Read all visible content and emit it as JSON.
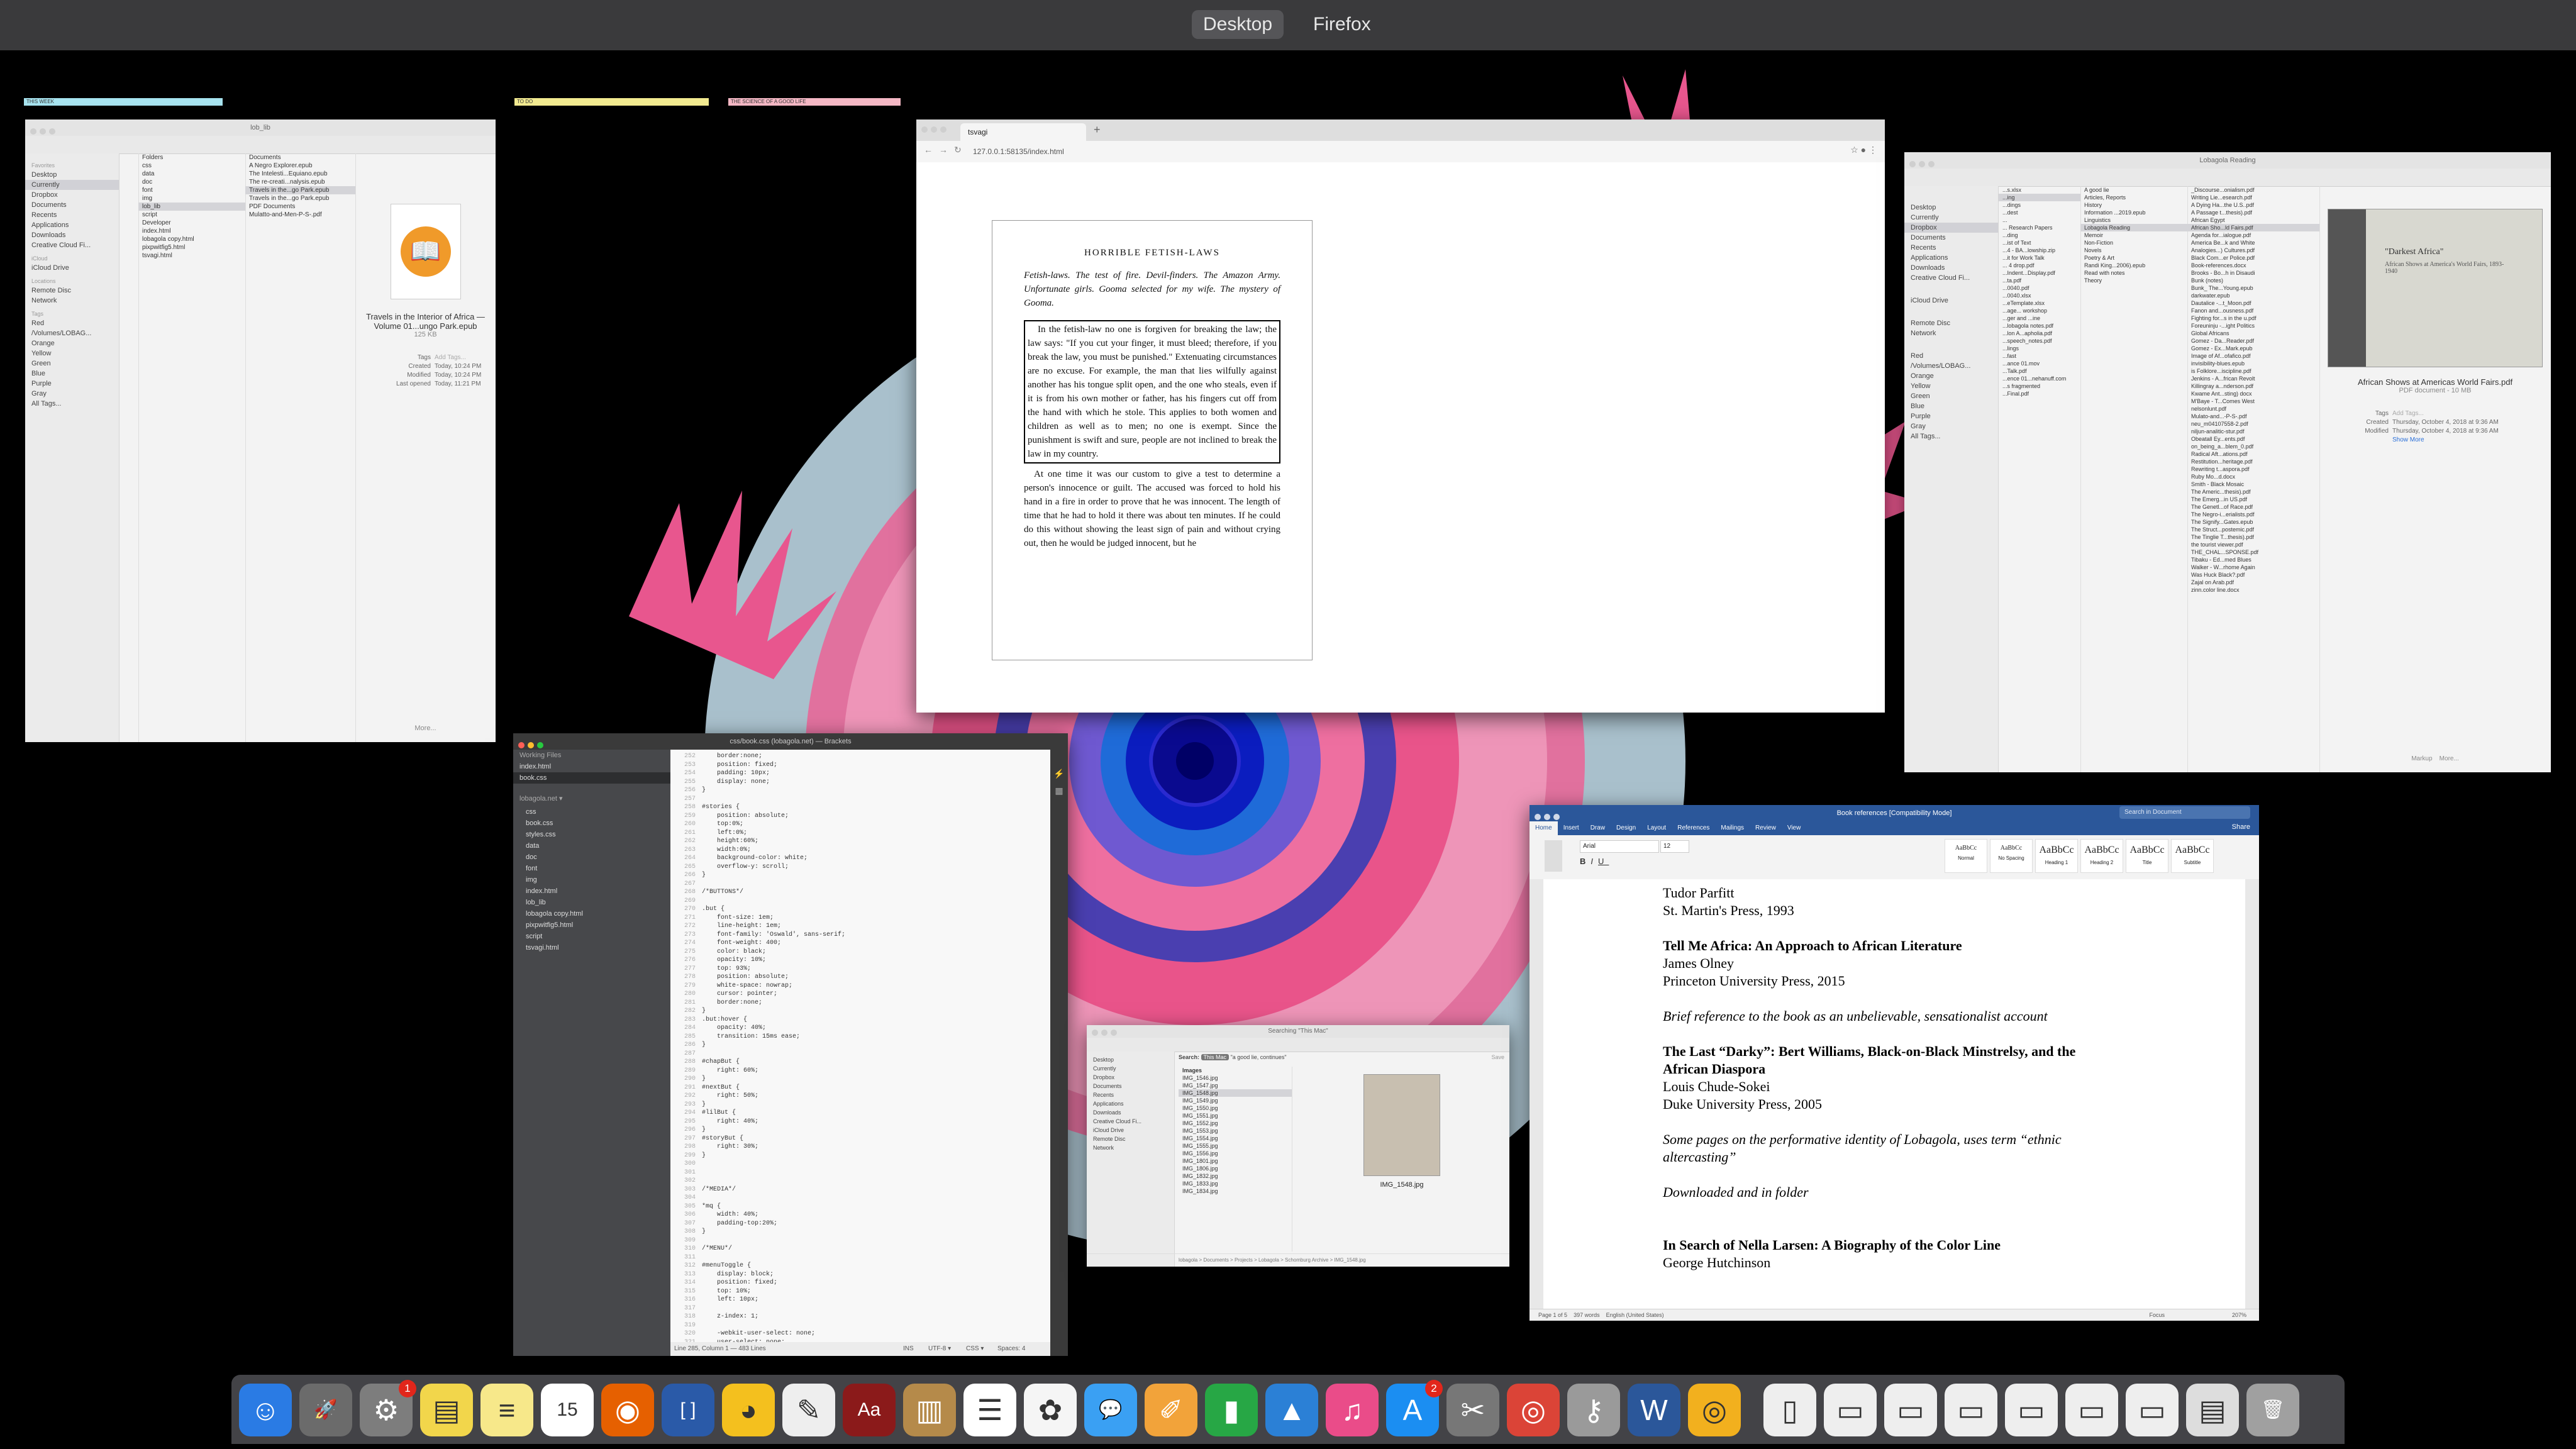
{
  "spaces": {
    "desktop_label": "Desktop",
    "firefox_label": "Firefox"
  },
  "stickies": [
    "THIS WEEK",
    "TO DO",
    "THE SCIENCE OF A GOOD LIFE"
  ],
  "finder1": {
    "title": "lob_lib",
    "sidebar_favorites_hdr": "Favorites",
    "favorites": [
      "Desktop",
      "Currently",
      "Dropbox",
      "Documents",
      "Recents",
      "Applications",
      "Downloads",
      "Creative Cloud Fi..."
    ],
    "icloud_hdr": "iCloud",
    "icloud": [
      "iCloud Drive"
    ],
    "locations_hdr": "Locations",
    "locations": [
      "Remote Disc",
      "Network"
    ],
    "tags_hdr": "Tags",
    "tags": [
      "Red",
      "/Volumes/LOBAG...",
      "Orange",
      "Yellow",
      "Green",
      "Blue",
      "Purple",
      "Gray",
      "All Tags..."
    ],
    "folders_hdr": "Folders",
    "folders": [
      "css",
      "data",
      "doc",
      "font",
      "img",
      "lob_lib",
      "script"
    ],
    "developer_hdr": "Developer",
    "developer": [
      "index.html",
      "lobagola copy.html",
      "pixpwitfig5.html",
      "tsvagi.html"
    ],
    "documents_hdr": "Documents",
    "documents": [
      "A Negro Explorer.epub",
      "The Intelesti...Equiano.epub",
      "The re-creati...nalysis.epub",
      "Travels in the...go Park.epub",
      "Travels in the...go Park.epub"
    ],
    "pdf_hdr": "PDF Documents",
    "pdfs": [
      "Mulatto-and-Men-P-S-.pdf"
    ],
    "preview_name": "Travels in the Interior of Africa — Volume 01...ungo Park.epub",
    "preview_size": "125 KB",
    "tags_label": "Tags",
    "add_tags": "Add Tags...",
    "created_label": "Created",
    "created": "Today, 10:24 PM",
    "modified_label": "Modified",
    "modified": "Today, 10:24 PM",
    "last_opened_label": "Last opened",
    "last_opened": "Today, 11:21 PM",
    "more": "More..."
  },
  "browser": {
    "tab_title": "tsvagi",
    "url": "127.0.0.1:58135/index.html",
    "book_title": "HORRIBLE FETISH-LAWS",
    "intro": "Fetish-laws. The test of fire. Devil-finders. The Amazon Army. Unfortunate girls. Gooma selected for my wife. The mystery of Gooma.",
    "boxed_para": "In the fetish-law no one is forgiven for breaking the law; the law says: \"If you cut your finger, it must bleed; therefore, if you break the law, you must be punished.\" Extenuating circumstances are no excuse. For example, the man that lies wilfully against another has his tongue split open, and the one who steals, even if it is from his own mother or father, has his fingers cut off from the hand with which he stole. This applies to both women and children as well as to men; no one is exempt. Since the punishment is swift and sure, people are not inclined to break the law in my country.",
    "para2": "At one time it was our custom to give a test to determine a person's innocence or guilt. The accused was forced to hold his hand in a fire in order to prove that he was innocent. The length of time that he had to hold it there was about ten minutes. If he could do this without showing the least sign of pain and without crying out, then he would be judged innocent, but he"
  },
  "finder2": {
    "title": "Lobagola Reading",
    "favorites": [
      "Desktop",
      "Currently",
      "Dropbox",
      "Documents",
      "Recents",
      "Applications",
      "Downloads",
      "Creative Cloud Fi..."
    ],
    "icloud": [
      "iCloud Drive"
    ],
    "locations": [
      "Remote Disc",
      "Network"
    ],
    "tags": [
      "Red",
      "/Volumes/LOBAG...",
      "Orange",
      "Yellow",
      "Green",
      "Blue",
      "Purple",
      "Gray",
      "All Tags..."
    ],
    "col1": [
      "...s.xlsx",
      "...ing",
      "...dings",
      "...dest",
      "...",
      "... Research Papers",
      "...ding",
      "...ist of Text",
      "...4 - BA...lowship.zip",
      "...it for Work Talk",
      "... 4 drop.pdf",
      "...Indent...Display.pdf",
      "...ta.pdf",
      "...0040.pdf",
      "...0040.xlsx",
      "...eTemplate.xlsx",
      "...age... workshop",
      "...ger and ...ine",
      "...lobagola notes.pdf",
      "...lon A...apholia.pdf",
      "...speech_notes.pdf",
      "...lings",
      "...fast",
      "...ance 01.mov",
      "...Talk.pdf",
      "...ence 01...nehanuff.com",
      "...s fragmented",
      "...Final.pdf"
    ],
    "col2": [
      "A good lie",
      "Articles, Reports",
      "History",
      "Information ...2019.epub",
      "Linguistics",
      "Lobagola Reading",
      "Memoir",
      "Non-Fiction",
      "Novels",
      "Poetry & Art",
      "Randi King...2006).epub",
      "Read with notes",
      "Theory"
    ],
    "col3": [
      "_Discourse...onialism.pdf",
      "Writing Lie...esearch.pdf",
      "A Dying Ha...the U.S..pdf",
      "A Passage t...thesis).pdf",
      "African Egypt",
      "African Sho...ld Fairs.pdf",
      "Agenda for...ialogue.pdf",
      "America Be...k and White",
      "Analogies...) Cultures.pdf",
      "Black Com...er Police.pdf",
      "Book-references.docx",
      "Brooks - Bo...h in Disaudi",
      "Bunk (notes)",
      "Bunk_ The...Young.epub",
      "darkwater.epub",
      "Dautalice -...t_Moon.pdf",
      "Fanon and...ousness.pdf",
      "Fighting for...s in the u.pdf",
      "Foreuninju -...ight Politics",
      "Global Africans",
      "Gomez - Da...Reader.pdf",
      "Gomez - Ex...Mark.epub",
      "Image of Af...ofafico.pdf",
      "invisibility-blues.epub",
      "is Folklore...iscipline.pdf",
      "Jenkins - A...frican Revolt",
      "Killingray a...nderson.pdf",
      "Kwame Ant...sting) docx",
      "M'Baye - T...Comes West",
      "nelsonlunt.pdf",
      "Mulato-and...-P-S-.pdf",
      "neu_m04107558-2.pdf",
      "niljun-analitic-stur.pdf",
      "Obeatall Ey...ents.pdf",
      "on_being_a...blem_0.pdf",
      "Radical Aft...ations.pdf",
      "Restitution...heritage.pdf",
      "Rewriting t...aspora.pdf",
      "Ruby Mo...d.docx",
      "Smith - Black Mosaic",
      "The Americ...thesis).pdf",
      "The Emerg...in US.pdf",
      "The Genetl...of Race.pdf",
      "The Negro-i...erialists.pdf",
      "The Signify...Gates.epub",
      "The Struct...postemic.pdf",
      "The Tinglie T...thesis).pdf",
      "the tourist viewer.pdf",
      "THE_CHAL...SPONSE.pdf",
      "Tibaku - Ed...med Blues",
      "Walker - W...rhome Again",
      "Was Huck Black?.pdf",
      "Zajal on Arab.pdf",
      "zinn.color line.docx"
    ],
    "preview_name": "African Shows at Americas World Fairs.pdf",
    "preview_kind": "PDF document - 10 MB",
    "preview_page_title": "\"Darkest Africa\"",
    "preview_page_sub": "African Shows at America's World Fairs, 1893-1940",
    "tags_label": "Tags",
    "add_tags": "Add Tags...",
    "created_label": "Created",
    "created": "Thursday, October 4, 2018 at 9:36 AM",
    "modified_label": "Modified",
    "modified": "Thursday, October 4, 2018 at 9:36 AM",
    "show_more": "Show More",
    "markup": "Markup",
    "more": "More..."
  },
  "brackets": {
    "title": "css/book.css (lobagola.net) — Brackets",
    "working_files_hdr": "Working Files",
    "working_files": [
      "index.html",
      "book.css"
    ],
    "project_hdr": "lobagola.net ▾",
    "tree": [
      "css",
      "book.css",
      "styles.css",
      "data",
      "doc",
      "font",
      "img",
      "index.html",
      "lob_lib",
      "lobagola copy.html",
      "pixpwitfig5.html",
      "script",
      "tsvagi.html"
    ],
    "code_lines": [
      [
        "252",
        "    border:none;"
      ],
      [
        "253",
        "    position: fixed;"
      ],
      [
        "254",
        "    padding: 10px;"
      ],
      [
        "255",
        "    display: none;"
      ],
      [
        "256",
        "}"
      ],
      [
        "257",
        ""
      ],
      [
        "258",
        "#stories {"
      ],
      [
        "259",
        "    position: absolute;"
      ],
      [
        "260",
        "    top:0%;"
      ],
      [
        "261",
        "    left:0%;"
      ],
      [
        "262",
        "    height:60%;"
      ],
      [
        "263",
        "    width:0%;"
      ],
      [
        "264",
        "    background-color: white;"
      ],
      [
        "265",
        "    overflow-y: scroll;"
      ],
      [
        "266",
        "}"
      ],
      [
        "267",
        ""
      ],
      [
        "268",
        "/*BUTTONS*/"
      ],
      [
        "269",
        ""
      ],
      [
        "270",
        ".but {"
      ],
      [
        "271",
        "    font-size: 1em;"
      ],
      [
        "272",
        "    line-height: 1em;"
      ],
      [
        "273",
        "    font-family: 'Oswald', sans-serif;"
      ],
      [
        "274",
        "    font-weight: 400;"
      ],
      [
        "275",
        "    color: black;"
      ],
      [
        "276",
        "    opacity: 10%;"
      ],
      [
        "277",
        "    top: 93%;"
      ],
      [
        "278",
        "    position: absolute;"
      ],
      [
        "279",
        "    white-space: nowrap;"
      ],
      [
        "280",
        "    cursor: pointer;"
      ],
      [
        "281",
        "    border:none;"
      ],
      [
        "282",
        "}"
      ],
      [
        "283",
        ".but:hover {"
      ],
      [
        "284",
        "    opacity: 40%;"
      ],
      [
        "285",
        "    transition: 15ms ease;"
      ],
      [
        "286",
        "}"
      ],
      [
        "287",
        ""
      ],
      [
        "288",
        "#chapBut {"
      ],
      [
        "289",
        "    right: 60%;"
      ],
      [
        "290",
        "}"
      ],
      [
        "291",
        "#nextBut {"
      ],
      [
        "292",
        "    right: 50%;"
      ],
      [
        "293",
        "}"
      ],
      [
        "294",
        "#lilBut {"
      ],
      [
        "295",
        "    right: 40%;"
      ],
      [
        "296",
        "}"
      ],
      [
        "297",
        "#storyBut {"
      ],
      [
        "298",
        "    right: 30%;"
      ],
      [
        "299",
        "}"
      ],
      [
        "300",
        ""
      ],
      [
        "301",
        ""
      ],
      [
        "302",
        ""
      ],
      [
        "303",
        "/*MEDIA*/"
      ],
      [
        "304",
        ""
      ],
      [
        "305",
        "*mq {"
      ],
      [
        "306",
        "    width: 40%;"
      ],
      [
        "307",
        "    padding-top:20%;"
      ],
      [
        "308",
        "}"
      ],
      [
        "309",
        ""
      ],
      [
        "310",
        "/*MENU*/"
      ],
      [
        "311",
        ""
      ],
      [
        "312",
        "#menuToggle {"
      ],
      [
        "313",
        "    display: block;"
      ],
      [
        "314",
        "    position: fixed;"
      ],
      [
        "315",
        "    top: 10%;"
      ],
      [
        "316",
        "    left: 10px;"
      ],
      [
        "317",
        ""
      ],
      [
        "318",
        "    z-index: 1;"
      ],
      [
        "319",
        ""
      ],
      [
        "320",
        "    -webkit-user-select: none;"
      ],
      [
        "321",
        "    user-select: none;"
      ]
    ],
    "status": "Line 285, Column 1 — 483 Lines",
    "ins": "INS",
    "encoding": "UTF-8 ▾",
    "lang": "CSS ▾",
    "spaces": "Spaces: 4"
  },
  "finder3": {
    "title": "Searching \"This Mac\"",
    "favorites": [
      "Desktop",
      "Currently",
      "Dropbox",
      "Documents",
      "Recents",
      "Applications",
      "Downloads",
      "Creative Cloud Fi..."
    ],
    "icloud": [
      "iCloud Drive"
    ],
    "locations": [
      "Remote Disc",
      "Network"
    ],
    "search_label": "Search:",
    "scope": "This Mac",
    "query": "\"a good lie, continues\"",
    "save": "Save",
    "images_hdr": "Images",
    "files": [
      "IMG_1546.jpg",
      "IMG_1547.jpg",
      "IMG_1548.jpg",
      "IMG_1549.jpg",
      "IMG_1550.jpg",
      "IMG_1551.jpg",
      "IMG_1552.jpg",
      "IMG_1553.jpg",
      "IMG_1554.jpg",
      "IMG_1555.jpg",
      "IMG_1556.jpg",
      "IMG_1801.jpg",
      "IMG_1806.jpg",
      "IMG_1832.jpg",
      "IMG_1833.jpg",
      "IMG_1834.jpg"
    ],
    "preview_name": "IMG_1548.jpg",
    "path": "lobagola > Documents > Projects > Lobagola > Schomburg Archive > IMG_1548.jpg"
  },
  "word": {
    "title": "Book references [Compatibility Mode]",
    "search_placeholder": "Search in Document",
    "tabs": [
      "Home",
      "Insert",
      "Draw",
      "Design",
      "Layout",
      "References",
      "Mailings",
      "Review",
      "View"
    ],
    "share": "Share",
    "font": "Arial",
    "size": "12",
    "styles": [
      "Normal",
      "No Spacing",
      "Heading 1",
      "Heading 2",
      "Title",
      "Subtitle"
    ],
    "lines": [
      {
        "t": "Tudor Parfitt",
        "s": ""
      },
      {
        "t": "St. Martin's Press, 1993",
        "s": ""
      },
      {
        "t": "",
        "s": "gap"
      },
      {
        "t": "Tell Me Africa: An Approach to African Literature",
        "s": "b"
      },
      {
        "t": "James Olney",
        "s": ""
      },
      {
        "t": "Princeton University Press, 2015",
        "s": ""
      },
      {
        "t": "",
        "s": "gap"
      },
      {
        "t": "Brief reference to the book as an unbelievable, sensationalist account",
        "s": "i"
      },
      {
        "t": "",
        "s": "gap"
      },
      {
        "t": "The Last “Darky”: Bert Williams, Black-on-Black Minstrelsy, and the",
        "s": "b"
      },
      {
        "t": "African Diaspora",
        "s": "b"
      },
      {
        "t": "Louis Chude-Sokei",
        "s": ""
      },
      {
        "t": "Duke University Press, 2005",
        "s": ""
      },
      {
        "t": "",
        "s": "gap"
      },
      {
        "t": "Some pages on the performative identity of Lobagola, uses term “ethnic",
        "s": "i"
      },
      {
        "t": "altercasting”",
        "s": "i"
      },
      {
        "t": "",
        "s": "gap"
      },
      {
        "t": "Downloaded and in folder",
        "s": "i"
      },
      {
        "t": "",
        "s": "gap"
      },
      {
        "t": "",
        "s": "gap"
      },
      {
        "t": "In Search of Nella Larsen: A Biography of the Color Line",
        "s": "b"
      },
      {
        "t": "George Hutchinson",
        "s": ""
      }
    ],
    "status_page": "Page 1 of 5",
    "status_words": "397 words",
    "status_lang": "English (United States)",
    "focus": "Focus",
    "zoom": "207%"
  },
  "dock": {
    "items": [
      {
        "name": "finder-icon",
        "glyph": "☺",
        "color": "#2a7be4"
      },
      {
        "name": "launchpad-icon",
        "glyph": "🚀",
        "color": "#6b6b6b"
      },
      {
        "name": "system-preferences-icon",
        "glyph": "⚙",
        "color": "#7d7d7d",
        "badge": "1"
      },
      {
        "name": "stickies-icon",
        "glyph": "▤",
        "color": "#f2d64b"
      },
      {
        "name": "notes-icon",
        "glyph": "≡",
        "color": "#f7e88a"
      },
      {
        "name": "calendar-icon",
        "glyph": "15",
        "color": "#ffffff"
      },
      {
        "name": "firefox-icon",
        "glyph": "◉",
        "color": "#e66000"
      },
      {
        "name": "brackets-icon",
        "glyph": "[ ]",
        "color": "#2a5aa8"
      },
      {
        "name": "cyberduck-icon",
        "glyph": "◕",
        "color": "#f4c01e"
      },
      {
        "name": "textedit-icon",
        "glyph": "✎",
        "color": "#eeeeee"
      },
      {
        "name": "dictionary-icon",
        "glyph": "Aa",
        "color": "#8b1a1a"
      },
      {
        "name": "notebook-icon",
        "glyph": "▥",
        "color": "#b58a4a"
      },
      {
        "name": "reminders-icon",
        "glyph": "☰",
        "color": "#ffffff"
      },
      {
        "name": "photos-icon",
        "glyph": "✿",
        "color": "#f5f5f5"
      },
      {
        "name": "messages-icon",
        "glyph": "💬",
        "color": "#3aa0f3"
      },
      {
        "name": "pages-icon",
        "glyph": "✐",
        "color": "#f2a33a"
      },
      {
        "name": "numbers-icon",
        "glyph": "▮",
        "color": "#27a745"
      },
      {
        "name": "keynote-icon",
        "glyph": "▲",
        "color": "#2b80d6"
      },
      {
        "name": "itunes-icon",
        "glyph": "♫",
        "color": "#ea4c89"
      },
      {
        "name": "app-store-icon",
        "glyph": "A",
        "color": "#1b8ef2",
        "badge": "2"
      },
      {
        "name": "utilities-icon",
        "glyph": "✂",
        "color": "#777777"
      },
      {
        "name": "chrome-icon",
        "glyph": "◎",
        "color": "#db4437"
      },
      {
        "name": "keychain-icon",
        "glyph": "⚷",
        "color": "#9a9a9a"
      },
      {
        "name": "word-icon",
        "glyph": "W",
        "color": "#2b579a"
      },
      {
        "name": "chrome-canary-icon",
        "glyph": "◎",
        "color": "#f2b01e"
      },
      {
        "name": "document-icon",
        "glyph": "▯",
        "color": "#eeeeee"
      },
      {
        "name": "firefox-window-icon",
        "glyph": "▭",
        "color": "#eeeeee"
      },
      {
        "name": "firefox-window-icon",
        "glyph": "▭",
        "color": "#eeeeee"
      },
      {
        "name": "firefox-window-icon",
        "glyph": "▭",
        "color": "#eeeeee"
      },
      {
        "name": "firefox-window-icon",
        "glyph": "▭",
        "color": "#eeeeee"
      },
      {
        "name": "firefox-window-icon",
        "glyph": "▭",
        "color": "#eeeeee"
      },
      {
        "name": "firefox-window-icon",
        "glyph": "▭",
        "color": "#eeeeee"
      },
      {
        "name": "document-icon",
        "glyph": "▤",
        "color": "#dddddd"
      },
      {
        "name": "trash-icon",
        "glyph": "🗑",
        "color": "#a0a0a0"
      }
    ]
  }
}
